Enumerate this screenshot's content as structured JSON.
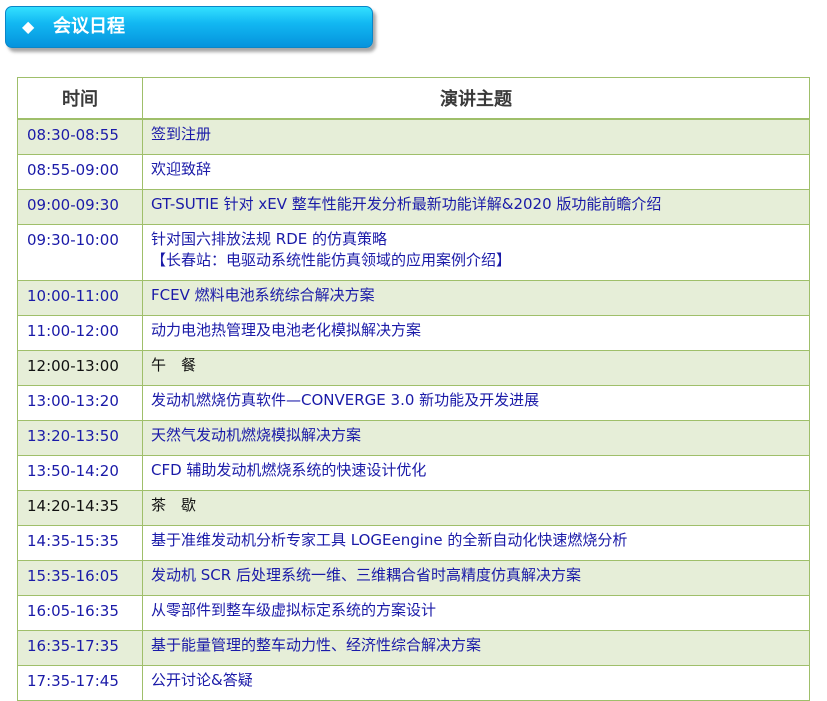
{
  "header": {
    "title": "会议日程"
  },
  "table": {
    "headers": {
      "time": "时间",
      "topic": "演讲主题"
    },
    "rows": [
      {
        "time": "08:30-08:55",
        "topic": "签到注册",
        "shaded": true
      },
      {
        "time": "08:55-09:00",
        "topic": "欢迎致辞",
        "shaded": false
      },
      {
        "time": "09:00-09:30",
        "topic": "GT-SUTIE 针对 xEV 整车性能开发分析最新功能详解&2020 版功能前瞻介绍",
        "shaded": true
      },
      {
        "time": "09:30-10:00",
        "topic": "针对国六排放法规 RDE 的仿真策略",
        "topic2": "【长春站：电驱动系统性能仿真领域的应用案例介绍】",
        "shaded": false
      },
      {
        "time": "10:00-11:00",
        "topic": "FCEV 燃料电池系统综合解决方案",
        "shaded": true
      },
      {
        "time": "11:00-12:00",
        "topic": "动力电池热管理及电池老化模拟解决方案",
        "shaded": false
      },
      {
        "time": "12:00-13:00",
        "topic": "午　餐",
        "shaded": true,
        "break": true
      },
      {
        "time": "13:00-13:20",
        "topic": "发动机燃烧仿真软件—CONVERGE 3.0 新功能及开发进展",
        "shaded": false
      },
      {
        "time": "13:20-13:50",
        "topic": "天然气发动机燃烧模拟解决方案",
        "shaded": true
      },
      {
        "time": "13:50-14:20",
        "topic": "CFD 辅助发动机燃烧系统的快速设计优化",
        "shaded": false
      },
      {
        "time": "14:20-14:35",
        "topic": "茶　歇",
        "shaded": true,
        "break": true
      },
      {
        "time": "14:35-15:35",
        "topic": "基于准维发动机分析专家工具 LOGEengine 的全新自动化快速燃烧分析",
        "shaded": false
      },
      {
        "time": "15:35-16:05",
        "topic": "发动机 SCR 后处理系统一维、三维耦合省时高精度仿真解决方案",
        "shaded": true
      },
      {
        "time": "16:05-16:35",
        "topic": "从零部件到整车级虚拟标定系统的方案设计",
        "shaded": false
      },
      {
        "time": "16:35-17:35",
        "topic": "基于能量管理的整车动力性、经济性综合解决方案",
        "shaded": true
      },
      {
        "time": "17:35-17:45",
        "topic": "公开讨论&答疑",
        "shaded": false
      }
    ]
  }
}
